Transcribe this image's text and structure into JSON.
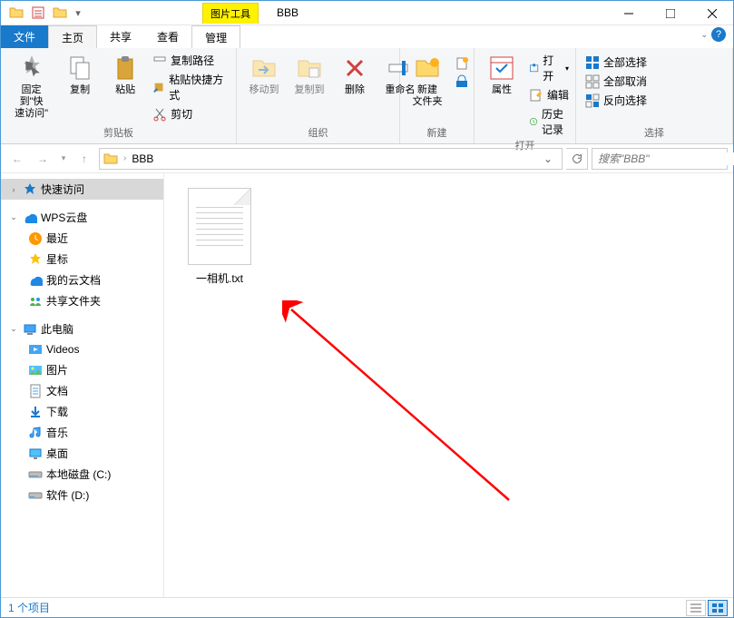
{
  "window": {
    "contextual_tab": "图片工具",
    "title": "BBB"
  },
  "tabs": {
    "file": "文件",
    "home": "主页",
    "share": "共享",
    "view": "查看",
    "manage": "管理"
  },
  "ribbon": {
    "pin": "固定到\"快\n速访问\"",
    "copy": "复制",
    "paste": "粘贴",
    "copy_path": "复制路径",
    "paste_shortcut": "粘贴快捷方式",
    "cut": "剪切",
    "clipboard_group": "剪贴板",
    "move_to": "移动到",
    "copy_to": "复制到",
    "delete": "删除",
    "rename": "重命名",
    "organize_group": "组织",
    "new_folder": "新建\n文件夹",
    "new_group": "新建",
    "properties": "属性",
    "open": "打开",
    "edit": "编辑",
    "history": "历史记录",
    "open_group": "打开",
    "select_all": "全部选择",
    "select_none": "全部取消",
    "invert_selection": "反向选择",
    "select_group": "选择"
  },
  "address": {
    "crumb": "BBB",
    "search_placeholder": "搜索\"BBB\""
  },
  "sidebar": {
    "quick_access": "快速访问",
    "wps": "WPS云盘",
    "recent": "最近",
    "star": "星标",
    "mydocs": "我的云文档",
    "shared": "共享文件夹",
    "this_pc": "此电脑",
    "videos": "Videos",
    "pictures": "图片",
    "documents": "文档",
    "downloads": "下载",
    "music": "音乐",
    "desktop": "桌面",
    "disk_c": "本地磁盘 (C:)",
    "disk_d": "软件 (D:)"
  },
  "files": {
    "item1": "一相机.txt"
  },
  "status": {
    "count": "1 个项目"
  }
}
